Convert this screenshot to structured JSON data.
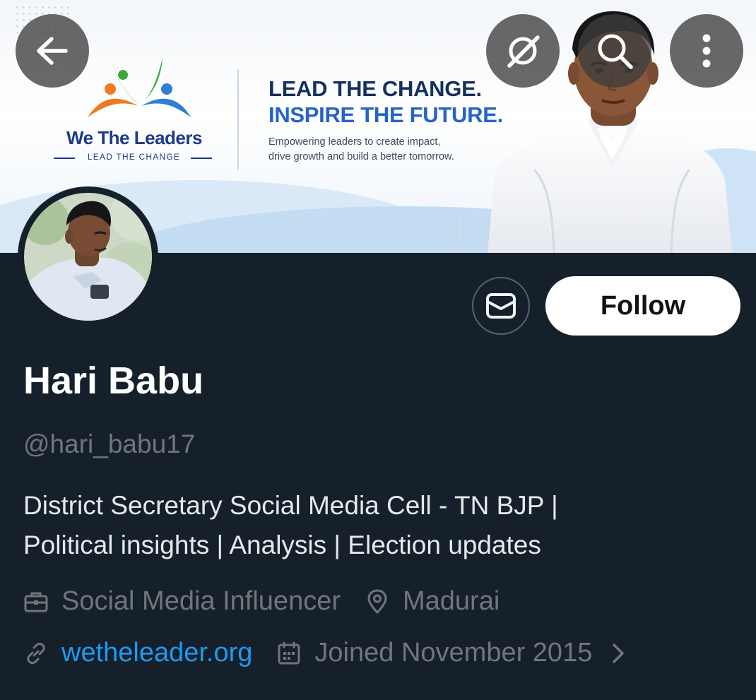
{
  "header": {
    "back_icon": "arrow-left-icon",
    "grok_icon": "slashed-circle-icon",
    "search_icon": "search-icon",
    "more_icon": "more-vertical-icon"
  },
  "banner": {
    "brand_name": "We The Leaders",
    "brand_tagline": "LEAD THE CHANGE",
    "headline_1": "LEAD THE CHANGE.",
    "headline_2": "INSPIRE THE FUTURE.",
    "tagline_line_1": "Empowering leaders to create impact,",
    "tagline_line_2": "drive growth and build a better tomorrow."
  },
  "actions": {
    "message_icon": "envelope-icon",
    "follow_label": "Follow"
  },
  "profile": {
    "display_name": "Hari Babu",
    "handle": "@hari_babu17",
    "bio_line_1": "District Secretary Social Media Cell - TN BJP |",
    "bio_line_2": "Political insights | Analysis | Election updates",
    "category": "Social Media Influencer",
    "location": "Madurai",
    "website": "wetheleader.org",
    "joined": "Joined November 2015"
  },
  "colors": {
    "background": "#15202b",
    "text_primary": "#e7e9ea",
    "text_secondary": "#71767b",
    "link": "#1d9bf0",
    "follow_bg": "#ffffff",
    "brand_navy": "#1e3a8a",
    "brand_blue": "#2563c9"
  }
}
